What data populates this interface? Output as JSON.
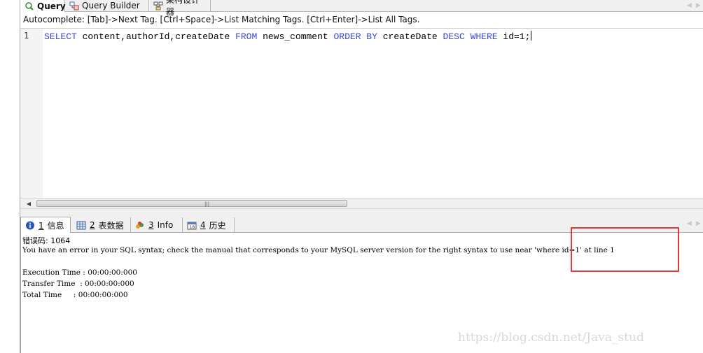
{
  "top_tabs": [
    {
      "label": "Query",
      "active": true,
      "icon": "query-icon"
    },
    {
      "label": "Query Builder",
      "active": false,
      "icon": "query-builder-icon"
    },
    {
      "label": "架构设计器",
      "active": false,
      "icon": "schema-designer-icon"
    }
  ],
  "autocomplete_hint": "Autocomplete: [Tab]->Next Tag. [Ctrl+Space]->List Matching Tags. [Ctrl+Enter]->List All Tags.",
  "editor": {
    "line_number": "1",
    "tokens": [
      {
        "t": "SELECT",
        "kw": true
      },
      {
        "t": " content,authorId,createDate ",
        "kw": false
      },
      {
        "t": "FROM",
        "kw": true
      },
      {
        "t": " news_comment ",
        "kw": false
      },
      {
        "t": "ORDER BY",
        "kw": true
      },
      {
        "t": " createDate ",
        "kw": false
      },
      {
        "t": "DESC",
        "kw": true
      },
      {
        "t": " ",
        "kw": false
      },
      {
        "t": "WHERE",
        "kw": true
      },
      {
        "t": " id=1;",
        "kw": false
      }
    ]
  },
  "bottom_tabs": [
    {
      "num": "1",
      "label": "信息",
      "active": true,
      "icon": "info-icon"
    },
    {
      "num": "2",
      "label": "表数据",
      "active": false,
      "icon": "table-data-icon"
    },
    {
      "num": "3",
      "label": "Info",
      "active": false,
      "icon": "info-chart-icon"
    },
    {
      "num": "4",
      "label": "历史",
      "active": false,
      "icon": "history-icon"
    }
  ],
  "messages": {
    "error_code_line": "错误码: 1064",
    "error_message": "You have an error in your SQL syntax; check the manual that corresponds to your MySQL server version for the right syntax to use near 'where id=1' at line 1",
    "execution_time": "Execution Time : 00:00:00:000",
    "transfer_time": "Transfer Time  : 00:00:00:000",
    "total_time": "Total Time     : 00:00:00:000"
  },
  "watermark": "https://blog.csdn.net/Java_stud",
  "colors": {
    "keyword": "#3a47d4",
    "highlight_box": "#e23a3a",
    "tab_bar_bg": "#f0f0f0"
  }
}
